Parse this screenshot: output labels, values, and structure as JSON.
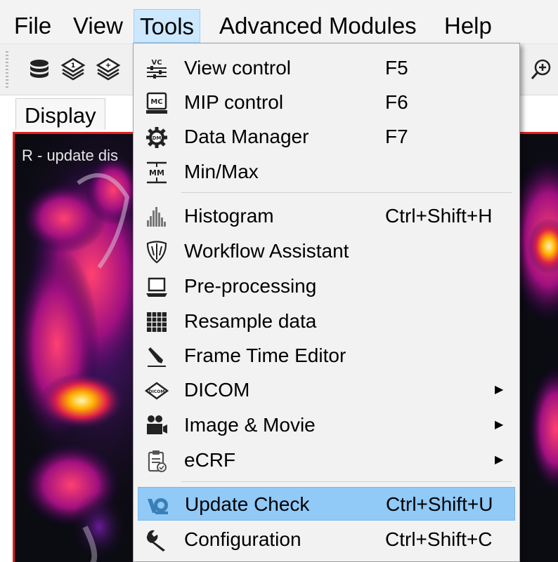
{
  "menubar": {
    "items": [
      {
        "label": "File"
      },
      {
        "label": "View"
      },
      {
        "label": "Tools"
      },
      {
        "label": "Advanced Modules"
      },
      {
        "label": "Help"
      }
    ]
  },
  "toolbar": {
    "icons": [
      "database-icon",
      "layers-1-icon",
      "layers-add-icon",
      "zoom-in-icon"
    ]
  },
  "display": {
    "tab_label": "Display",
    "viewer_caption": "R - update dis"
  },
  "tools_menu": {
    "items": [
      {
        "label": "View control",
        "shortcut": "F5",
        "icon": "view-control-icon",
        "icon_text": "VC"
      },
      {
        "label": "MIP control",
        "shortcut": "F6",
        "icon": "mip-control-icon",
        "icon_text": "MC"
      },
      {
        "label": "Data Manager",
        "shortcut": "F7",
        "icon": "data-manager-gear-icon",
        "icon_text": "DM"
      },
      {
        "label": "Min/Max",
        "shortcut": "",
        "icon": "min-max-icon",
        "icon_text": "MM"
      },
      {
        "label": "Histogram",
        "shortcut": "Ctrl+Shift+H",
        "icon": "histogram-icon"
      },
      {
        "label": "Workflow Assistant",
        "shortcut": "",
        "icon": "workflow-shield-icon"
      },
      {
        "label": "Pre-processing",
        "shortcut": "",
        "icon": "laptop-icon"
      },
      {
        "label": "Resample data",
        "shortcut": "",
        "icon": "grid-icon"
      },
      {
        "label": "Frame Time Editor",
        "shortcut": "",
        "icon": "pencil-icon"
      },
      {
        "label": "DICOM",
        "shortcut": "",
        "icon": "dicom-icon",
        "submenu": true
      },
      {
        "label": "Image & Movie",
        "shortcut": "",
        "icon": "movie-camera-icon",
        "submenu": true
      },
      {
        "label": "eCRF",
        "shortcut": "",
        "icon": "clipboard-icon",
        "submenu": true
      },
      {
        "label": "Update Check",
        "shortcut": "Ctrl+Shift+U",
        "icon": "update-check-icon",
        "highlighted": true
      },
      {
        "label": "Configuration",
        "shortcut": "Ctrl+Shift+C",
        "icon": "wrench-icon"
      }
    ],
    "submenu_arrow": "▶"
  },
  "colors": {
    "menu_highlight": "#91c9f7",
    "menubar_active": "#cce8ff",
    "viewer_border": "#e02020"
  }
}
